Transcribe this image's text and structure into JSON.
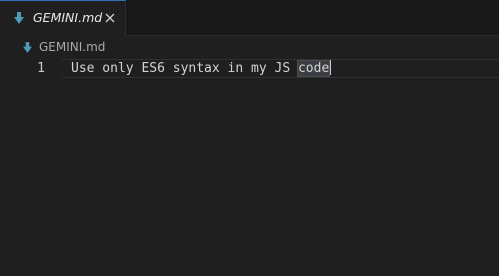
{
  "tab": {
    "label": "GEMINI.md",
    "icon": "markdown-arrow-icon",
    "close_icon": "close-icon",
    "accent_color": "#2f6fb7"
  },
  "breadcrumb": {
    "label": "GEMINI.md",
    "icon": "markdown-arrow-icon"
  },
  "editor": {
    "lines": [
      {
        "number": "1",
        "text_before": "Use only ES6 syntax in my JS ",
        "highlighted_word": "code"
      }
    ]
  }
}
